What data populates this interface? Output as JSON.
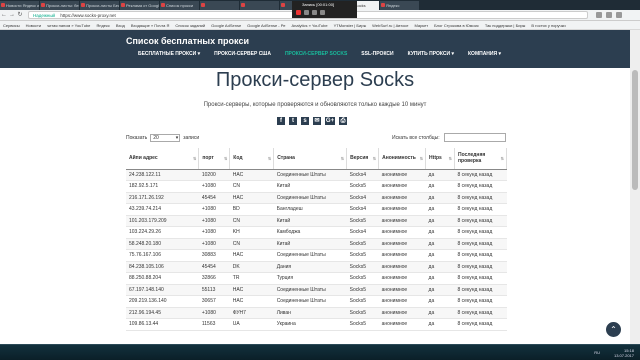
{
  "browser": {
    "tabs": [
      {
        "title": "Новости Яндекс ищущих",
        "active": false
      },
      {
        "title": "Прокси-листы: бесплатные",
        "active": false
      },
      {
        "title": "Прокси-листы Бесплатные",
        "active": false
      },
      {
        "title": "Реклама от Google",
        "active": false
      },
      {
        "title": "Список прокси",
        "active": false
      },
      {
        "title": "",
        "active": false
      },
      {
        "title": "",
        "active": false
      },
      {
        "title": "",
        "active": false
      },
      {
        "title": "Прокси-сервер Socks",
        "active": true
      },
      {
        "title": "Яндекс",
        "active": false
      }
    ],
    "recording_label": "Запись [00:01:00]",
    "secure_label": "Надежный",
    "url": "https://www.socks-proxy.net",
    "bookmarks": [
      "Сервисы",
      "Новости",
      "читая папом » YouTube",
      "Яндекс",
      "Вход",
      "Входящие » Почта Я",
      "Список заданий",
      "Google AdSense",
      "Google AdSense - Ре",
      "Analytics » YouTube",
      "YTMonster | Бирж",
      "WebSurf.ru | Автосе",
      "Маркет",
      "Блог Строкова в Юмоис",
      "Так поддержки | Бирж",
      "В гостях у поручки"
    ]
  },
  "site": {
    "title": "Список бесплатных прокси",
    "nav": [
      {
        "label": "БЕСПЛАТНЫЕ ПРОКСИ ▾",
        "active": false
      },
      {
        "label": "ПРОКСИ-СЕРВЕР США",
        "active": false
      },
      {
        "label": "ПРОКСИ-СЕРВЕР SOCKS",
        "active": true
      },
      {
        "label": "SSL-ПРОКСИ",
        "active": false
      },
      {
        "label": "КУПИТЬ ПРОКСИ ▾",
        "active": false
      },
      {
        "label": "КОМПАНИЯ ▾",
        "active": false
      }
    ]
  },
  "main": {
    "heading": "Прокси-сервер Socks",
    "subtitle": "Прокси-серверы, которые проверяются и обновляются только каждые 10 минут",
    "social_icons": [
      "f",
      "t",
      "s",
      "✉",
      "G+",
      "⎙"
    ],
    "show_label": "Показать",
    "show_value": "20",
    "show_suffix": "записи",
    "search_label": "Искать все столбцы:"
  },
  "table": {
    "headers": [
      "Айпи адрес",
      "порт",
      "Код",
      "Страна",
      "Версия",
      "Анонимность",
      "Https",
      "Последняя проверка"
    ],
    "rows": [
      [
        "24.238.122.11",
        "10200",
        "НАС",
        "Соединенные Штаты",
        "Socks4",
        "анонимное",
        "да",
        "8 секунд назад"
      ],
      [
        "182.92.5.171",
        "+1080",
        "CN",
        "Китай",
        "Socks5",
        "анонимное",
        "да",
        "8 секунд назад"
      ],
      [
        "216.171.26.192",
        "45454",
        "НАС",
        "Соединенные Штаты",
        "Socks4",
        "анонимное",
        "да",
        "8 секунд назад"
      ],
      [
        "43.239.74.214",
        "+1080",
        "BD",
        "Бангладеш",
        "Socks4",
        "анонимное",
        "да",
        "8 секунд назад"
      ],
      [
        "101.203.179.209",
        "+1080",
        "CN",
        "Китай",
        "Socks5",
        "анонимное",
        "да",
        "8 секунд назад"
      ],
      [
        "103.224.29.26",
        "+1080",
        "KH",
        "Камбоджа",
        "Socks4",
        "анонимное",
        "да",
        "8 секунд назад"
      ],
      [
        "58.248.20.180",
        "+1080",
        "CN",
        "Китай",
        "Socks5",
        "анонимное",
        "да",
        "8 секунд назад"
      ],
      [
        "75.76.167.106",
        "30883",
        "НАС",
        "Соединенные Штаты",
        "Socks5",
        "анонимное",
        "да",
        "8 секунд назад"
      ],
      [
        "84.238.105.106",
        "45454",
        "DK",
        "Дания",
        "Socks5",
        "анонимное",
        "да",
        "8 секунд назад"
      ],
      [
        "88.250.88.204",
        "32866",
        "TR",
        "Турция",
        "Socks5",
        "анонимное",
        "да",
        "8 секунд назад"
      ],
      [
        "67.197.148.140",
        "55113",
        "НАС",
        "Соединенные Штаты",
        "Socks5",
        "анонимное",
        "да",
        "8 секунд назад"
      ],
      [
        "209.219.136.140",
        "30657",
        "НАС",
        "Соединенные Штаты",
        "Socks5",
        "анонимное",
        "да",
        "8 секунд назад"
      ],
      [
        "212.96.194.45",
        "+1080",
        "ФУН7",
        "Ливан",
        "Socks5",
        "анонимное",
        "да",
        "8 секунд назад"
      ],
      [
        "109.86.13.44",
        "11563",
        "UA",
        "Украина",
        "Socks5",
        "анонимное",
        "да",
        "8 секунд назад"
      ]
    ]
  },
  "taskbar": {
    "lang": "RU",
    "time": "15:18",
    "date": "13.07.2017"
  }
}
